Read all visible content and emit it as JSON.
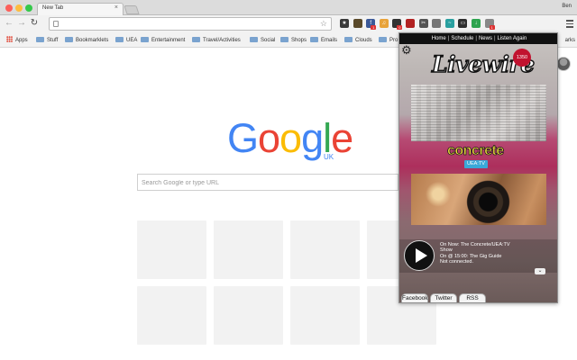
{
  "browser": {
    "tab_title": "New Tab",
    "tab_close": "×",
    "profile_name": "Ben",
    "bookmark_star": "☆",
    "nav_back": "←",
    "nav_forward": "→",
    "nav_reload": "↻"
  },
  "extensions": [
    {
      "icon": "livewire-ext-icon",
      "color": "#3a3a3a",
      "glyph": "★"
    },
    {
      "icon": "shield-ext-icon",
      "color": "#5a4a2a",
      "glyph": ""
    },
    {
      "icon": "facebook-ext-icon",
      "color": "#3b5998",
      "glyph": "f",
      "badge": "1"
    },
    {
      "icon": "headphones-ext-icon",
      "color": "#e8a33a",
      "glyph": "♫"
    },
    {
      "icon": "pocket-ext-icon",
      "color": "#333333",
      "glyph": "",
      "badge": "0"
    },
    {
      "icon": "car-ext-icon",
      "color": "#b22222",
      "glyph": ""
    },
    {
      "icon": "scissors-ext-icon",
      "color": "#555555",
      "glyph": "✂"
    },
    {
      "icon": "camera-ext-icon",
      "color": "#777777",
      "glyph": ""
    },
    {
      "icon": "pulse-ext-icon",
      "color": "#2aa0a0",
      "glyph": "~"
    },
    {
      "icon": "monitor-ext-icon",
      "color": "#2f2f2f",
      "glyph": "▭"
    },
    {
      "icon": "download-arrow-ext-icon",
      "color": "#2ea44f",
      "glyph": "↓"
    },
    {
      "icon": "alert-ext-icon",
      "color": "#888888",
      "glyph": "",
      "badge": "1"
    }
  ],
  "bookmarks": {
    "items": [
      "Apps",
      "Stuff",
      "Bookmarklets",
      "UEA",
      "Entertainment",
      "Travel/Activities",
      "Social",
      "Shops",
      "Emails",
      "Clouds",
      "Pro"
    ],
    "more": "arks"
  },
  "page": {
    "logo_letters": [
      {
        "char": "G",
        "color": "#4285f4"
      },
      {
        "char": "o",
        "color": "#ea4335"
      },
      {
        "char": "o",
        "color": "#fbbc05"
      },
      {
        "char": "g",
        "color": "#4285f4"
      },
      {
        "char": "l",
        "color": "#34a853"
      },
      {
        "char": "e",
        "color": "#ea4335"
      }
    ],
    "logo_region": "UK",
    "search_placeholder": "Search Google or type URL"
  },
  "popup": {
    "nav": [
      "Home",
      "Schedule",
      "News",
      "Listen Again"
    ],
    "nav_separator": "|",
    "brand": "Livewire",
    "frequency": "1350",
    "show_brand": "concrete",
    "show_sub": "UEA:TV",
    "now_playing": [
      "On Now: The Concrete/UEA:TV",
      "Show",
      "On @ 15:00: The Gig Guide",
      "Not connected."
    ],
    "expand_glyph": "⌄",
    "tabs": [
      "Facebook",
      "Twitter",
      "RSS"
    ]
  }
}
